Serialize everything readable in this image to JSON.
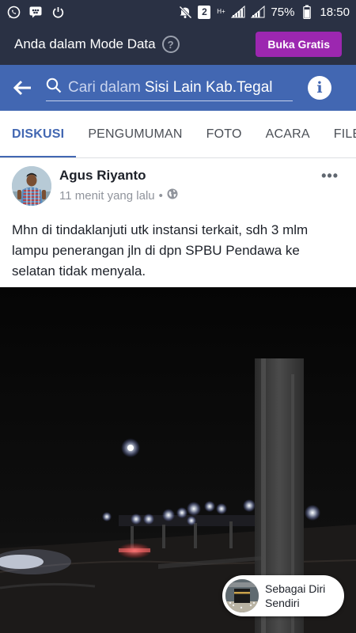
{
  "status_bar": {
    "left_icons": [
      "whatsapp-icon",
      "bbm-icon",
      "power-icon"
    ],
    "sim_label": "2",
    "network_type": "H+",
    "battery": "75%",
    "time": "18:50"
  },
  "data_banner": {
    "text": "Anda dalam Mode Data",
    "help_label": "?",
    "button_label": "Buka Gratis",
    "button_color": "#9c27b0"
  },
  "search": {
    "placeholder": "Cari dalam",
    "group_name": "Sisi Lain Kab.Tegal",
    "info_label": "i"
  },
  "tabs": [
    {
      "label": "DISKUSI",
      "active": true
    },
    {
      "label": "PENGUMUMAN",
      "active": false
    },
    {
      "label": "FOTO",
      "active": false
    },
    {
      "label": "ACARA",
      "active": false
    },
    {
      "label": "FILE",
      "active": false
    }
  ],
  "post": {
    "author": "Agus Riyanto",
    "time": "11 menit yang lalu",
    "separator": "•",
    "privacy_icon": "globe-icon",
    "more_label": "•••",
    "text": "Mhn di tindaklanjuti utk instansi terkait, sdh 3 mlm lampu penerangan jln di dpn SPBU Pendawa ke selatan tidak menyala."
  },
  "identity_pill": {
    "label": "Sebagai Diri Sendiri"
  },
  "colors": {
    "status_bg": "#2a3144",
    "header_blue": "#4267b2",
    "active_tab": "#4267b2"
  }
}
